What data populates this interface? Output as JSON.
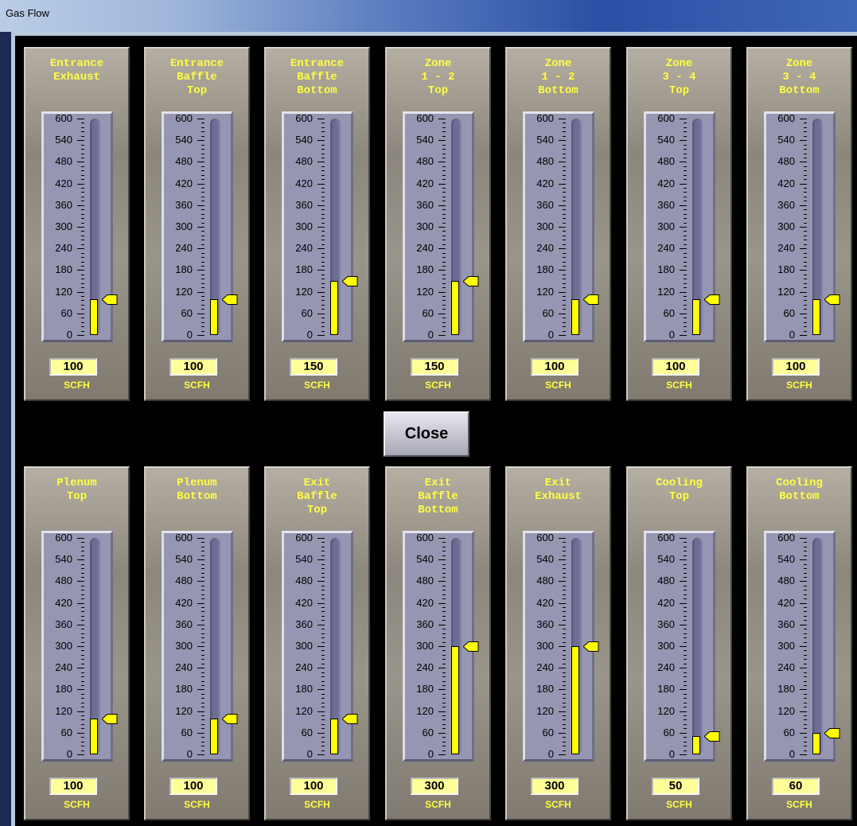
{
  "window": {
    "title": "Gas Flow"
  },
  "close_button": {
    "label": "Close"
  },
  "scale_ticks": [
    "600",
    "540",
    "480",
    "420",
    "360",
    "300",
    "240",
    "180",
    "120",
    "60",
    "0"
  ],
  "gauges": [
    {
      "name": "Entrance Exhaust",
      "label": "Entrance\nExhaust",
      "value": 100,
      "display": "100",
      "unit": "SCFH"
    },
    {
      "name": "Entrance Baffle Top",
      "label": "Entrance\nBaffle\nTop",
      "value": 100,
      "display": "100",
      "unit": "SCFH"
    },
    {
      "name": "Entrance Baffle Bottom",
      "label": "Entrance\nBaffle\nBottom",
      "value": 150,
      "display": "150",
      "unit": "SCFH"
    },
    {
      "name": "Zone 1-2 Top",
      "label": "Zone\n1 - 2\nTop",
      "value": 150,
      "display": "150",
      "unit": "SCFH"
    },
    {
      "name": "Zone 1-2 Bottom",
      "label": "Zone\n1 - 2\nBottom",
      "value": 100,
      "display": "100",
      "unit": "SCFH"
    },
    {
      "name": "Zone 3-4 Top",
      "label": "Zone\n3 - 4\nTop",
      "value": 100,
      "display": "100",
      "unit": "SCFH"
    },
    {
      "name": "Zone 3-4 Bottom",
      "label": "Zone\n3 - 4\nBottom",
      "value": 100,
      "display": "100",
      "unit": "SCFH"
    },
    {
      "name": "Plenum Top",
      "label": "Plenum\nTop",
      "value": 100,
      "display": "100",
      "unit": "SCFH"
    },
    {
      "name": "Plenum Bottom",
      "label": "Plenum\nBottom",
      "value": 100,
      "display": "100",
      "unit": "SCFH"
    },
    {
      "name": "Exit Baffle Top",
      "label": "Exit\nBaffle\nTop",
      "value": 100,
      "display": "100",
      "unit": "SCFH"
    },
    {
      "name": "Exit Baffle Bottom",
      "label": "Exit\nBaffle\nBottom",
      "value": 300,
      "display": "300",
      "unit": "SCFH"
    },
    {
      "name": "Exit Exhaust",
      "label": "Exit\nExhaust",
      "value": 300,
      "display": "300",
      "unit": "SCFH"
    },
    {
      "name": "Cooling Top",
      "label": "Cooling\nTop",
      "value": 50,
      "display": "50",
      "unit": "SCFH"
    },
    {
      "name": "Cooling Bottom",
      "label": "Cooling\nBottom",
      "value": 60,
      "display": "60",
      "unit": "SCFH"
    }
  ],
  "colors": {
    "label": "#ffff40",
    "fill": "#ffff00",
    "valbox": "#ffff99"
  }
}
